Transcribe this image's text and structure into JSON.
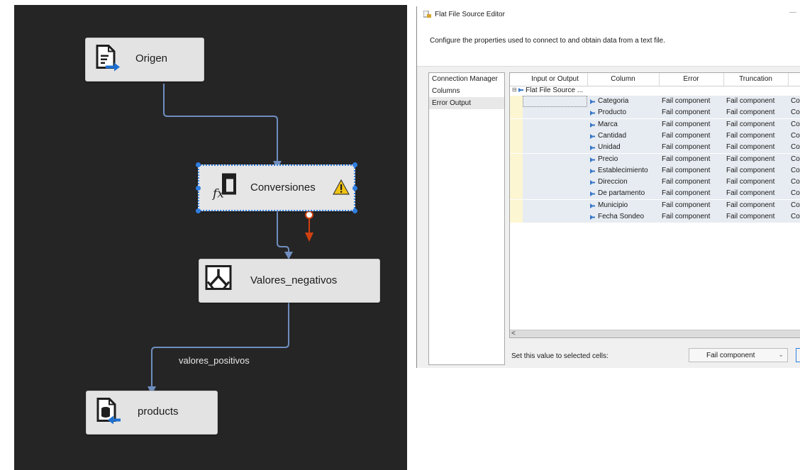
{
  "canvas": {
    "nodes": {
      "origen": {
        "label": "Origen",
        "icon": "flat-file-source-icon"
      },
      "conversiones": {
        "label": "Conversiones",
        "icon": "derived-column-fx-icon",
        "warning_icon": "warning-icon"
      },
      "valores_negativos": {
        "label": "Valores_negativos",
        "icon": "conditional-split-icon"
      },
      "products": {
        "label": "products",
        "icon": "db-destination-icon"
      }
    },
    "path_label": "valores_positivos",
    "colors": {
      "background": "#252526",
      "wire": "#6f8ebf",
      "error_wire": "#d04010",
      "selection": "#2f7ee0"
    }
  },
  "editor": {
    "window_title": "Flat File Source Editor",
    "description": "Configure the properties used to connect to and obtain data from a text file.",
    "nav_items": [
      "Connection Manager",
      "Columns",
      "Error Output"
    ],
    "active_nav": "Error Output",
    "grid": {
      "headers": [
        "Input or Output",
        "Column",
        "Error",
        "Truncation"
      ],
      "parent_label": "Flat File Source ...",
      "rows": [
        {
          "column": "Categoria",
          "error": "Fail component",
          "truncation": "Fail component",
          "extra": "Cor"
        },
        {
          "column": "Producto",
          "error": "Fail component",
          "truncation": "Fail component",
          "extra": "Cor"
        },
        {
          "column": "Marca",
          "error": "Fail component",
          "truncation": "Fail component",
          "extra": "Cor"
        },
        {
          "column": "Cantidad",
          "error": "Fail component",
          "truncation": "Fail component",
          "extra": "Cor"
        },
        {
          "column": "Unidad",
          "error": "Fail component",
          "truncation": "Fail component",
          "extra": "Cor"
        },
        {
          "column": "Precio",
          "error": "Fail component",
          "truncation": "Fail component",
          "extra": "Cor"
        },
        {
          "column": "Establecimiento",
          "error": "Fail component",
          "truncation": "Fail component",
          "extra": "Cor"
        },
        {
          "column": "Direccion",
          "error": "Fail component",
          "truncation": "Fail component",
          "extra": "Cor"
        },
        {
          "column": "De partamento",
          "error": "Fail component",
          "truncation": "Fail component",
          "extra": "Cor"
        },
        {
          "column": "Municipio",
          "error": "Fail component",
          "truncation": "Fail component",
          "extra": "Cor"
        },
        {
          "column": "Fecha Sondeo",
          "error": "Fail component",
          "truncation": "Fail component",
          "extra": "Cor"
        }
      ],
      "scroll_left_glyph": "<"
    },
    "set_value_label": "Set this value to selected cells:",
    "set_value_selected": "Fail component",
    "dropdown_glyph": "⌄",
    "min_glyph": "—"
  }
}
